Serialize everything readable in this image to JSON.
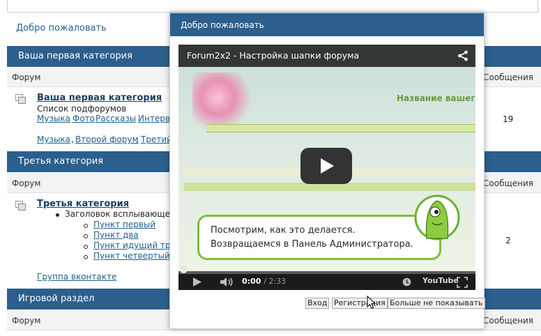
{
  "page": {
    "welcome_link": "Добро пожаловать",
    "columns": {
      "forum": "Форум",
      "messages": "Сообщения"
    }
  },
  "categories": [
    {
      "header": "Ваша первая категория",
      "forum_title": "Ваша первая категория",
      "subforums_label": "Список подфорумов",
      "subforum_links": [
        "Музыка",
        "Фото",
        "Рассказы",
        "Интерв"
      ],
      "row_links": [
        "Музыка",
        "Второй форум",
        "Третий"
      ],
      "messages": "19"
    },
    {
      "header": "Третья категория",
      "forum_title": "Третья категория",
      "popup_heading": "Заголовок всплывающег",
      "popup_items": [
        "Пункт первый",
        "Пункт два",
        "Пункт идущий тре",
        "Пункт четвертый"
      ],
      "group_link": "Группа вконтакте",
      "messages": "2"
    },
    {
      "header": "Игровой раздел"
    }
  ],
  "modal": {
    "title": "Добро пожаловать",
    "video": {
      "title": "Forum2x2 - Настройка шапки форума",
      "site_title": "Название вашего",
      "caption_line1": "Посмотрим, как это делается.",
      "caption_line2": "Возвращаемся в Панель Администратора.",
      "time_current": "0:00",
      "time_duration": "/ 2:33",
      "youtube_logo": "YouTube"
    },
    "buttons": {
      "login": "Вход",
      "register": "Регистрация",
      "dont_show": "Больше не показывать"
    }
  },
  "colors": {
    "header_bg": "#2c5f8d",
    "link": "#1f5f8b",
    "caption_border": "#7cbf3a"
  }
}
